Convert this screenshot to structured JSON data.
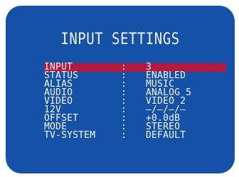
{
  "title": "INPUT SETTINGS",
  "rows": [
    {
      "label": "INPUT",
      "sep": ":",
      "value": "3",
      "selected": true
    },
    {
      "label": "STATUS",
      "sep": ":",
      "value": "ENABLED"
    },
    {
      "label": "ALIAS",
      "sep": ":",
      "value": "MUSIC"
    },
    {
      "label": "AUDIO",
      "sep": ":",
      "value": "ANALOG 5"
    },
    {
      "label": "VIDEO",
      "sep": ":",
      "value": "VIDEO 2"
    },
    {
      "label": "12V",
      "sep": ":",
      "value": "—/—/—/—"
    },
    {
      "label": "OFFSET",
      "sep": ":",
      "value": "+0.0dB"
    },
    {
      "label": "MODE",
      "sep": ":",
      "value": "STEREO"
    },
    {
      "label": "TV-SYSTEM",
      "sep": ":",
      "value": "DEFAULT"
    }
  ],
  "colors": {
    "screen_background": "#1552a7",
    "selected_row": "#b5193f",
    "text": "#f6f6f6"
  }
}
